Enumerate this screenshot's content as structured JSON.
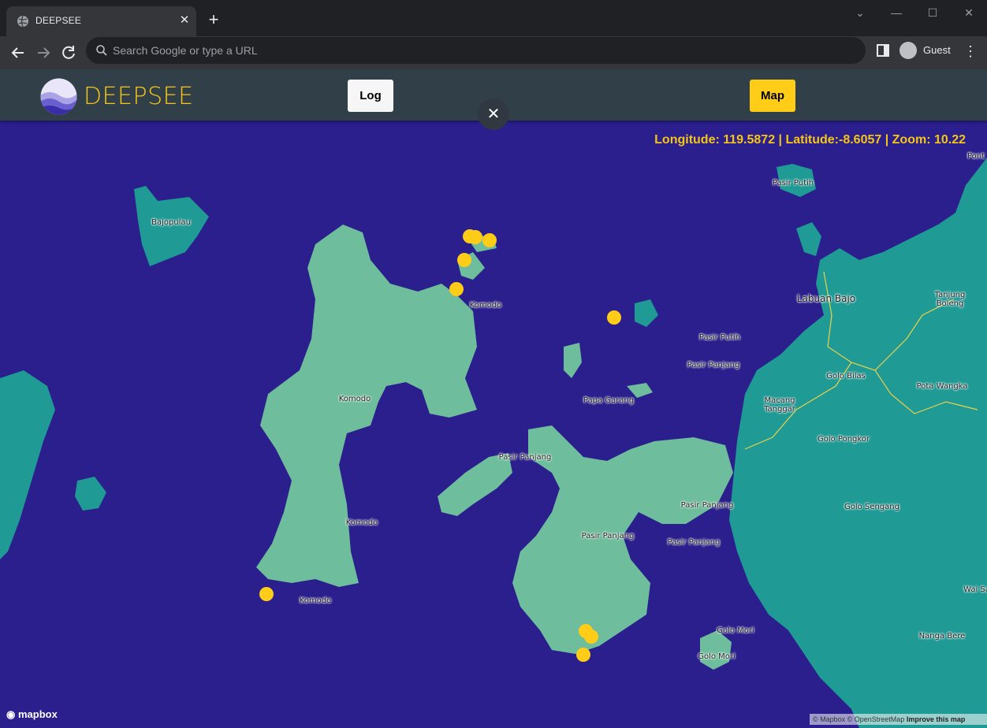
{
  "browser": {
    "tab_title": "DEEPSEE",
    "tab_close": "✕",
    "new_tab": "+",
    "omnibox_placeholder": "Search Google or type a URL",
    "profile_name": "Guest",
    "window_controls": [
      "⌄",
      "—",
      "☐",
      "✕"
    ]
  },
  "app": {
    "brand": "DEEPSEE",
    "log_button": "Log",
    "map_button": "Map",
    "close_button": "✕",
    "coords_text": "Longitude: 119.5872 | Latitude:-8.6057 | Zoom: 10.22",
    "accent_color": "#ffcc17",
    "ocean_color": "#2a1f8c"
  },
  "map": {
    "labels": {
      "bajopulau": "Bajopulau",
      "pasir_putih_top": "Pasir Putih",
      "komodo_north": "Komodo",
      "labuan_bajo": "Labuan Bajo",
      "tanjung_boleng": "Tanjung Boleng",
      "pasir_putih_mid": "Pasir Putih",
      "pasir_panjang_1": "Pasir Panjang",
      "golo_bilas": "Golo Bilas",
      "pota_wangka": "Pota Wangka",
      "komodo_central": "Komodo",
      "papa_garang": "Papa Garang",
      "macang_tanggar": "Macang Tanggar",
      "golo_pongkor": "Golo Pongkor",
      "pasir_panjang_2": "Pasir Panjang",
      "pasir_panjang_3": "Pasir Panjang",
      "golo_sengang": "Golo Sengang",
      "komodo_south": "Komodo",
      "pasir_panjang_4": "Pasir Panjang",
      "pasir_panjang_5": "Pasir Panjang",
      "komodo_sw": "Komodo",
      "golo_mori_1": "Golo Mori",
      "golo_mori_2": "Golo Mori",
      "nanga_bere": "Nanga Bere",
      "wai_sa": "Wai Sa",
      "pont": "Pont"
    },
    "mapbox_logo": "mapbox",
    "attribution": "© Mapbox © OpenStreetMap",
    "improve": "Improve this map",
    "marker_color": "#ffcc17",
    "marker_count": 12
  }
}
